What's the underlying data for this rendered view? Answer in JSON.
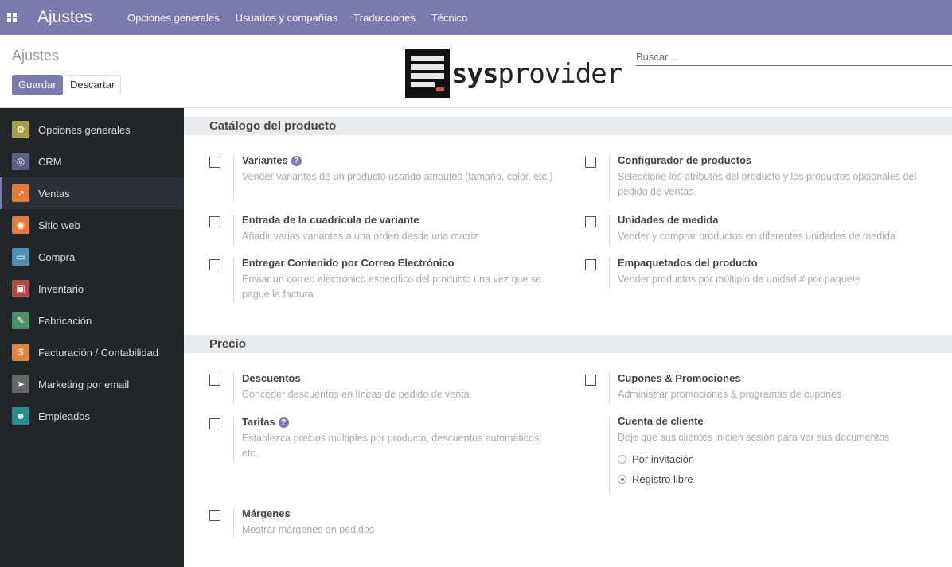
{
  "navbar": {
    "app_title": "Ajustes",
    "menu": [
      "Opciones generales",
      "Usuarios y compañías",
      "Traducciones",
      "Técnico"
    ]
  },
  "control_panel": {
    "title": "Ajustes",
    "save_label": "Guardar",
    "discard_label": "Descartar",
    "logo_text_bold": "sys",
    "logo_text": "provider",
    "search_placeholder": "Buscar..."
  },
  "sidebar": {
    "items": [
      {
        "label": "Opciones generales",
        "icon": "gear-icon",
        "color": "#a5a14b",
        "glyph": "⚙"
      },
      {
        "label": "CRM",
        "icon": "handshake-icon",
        "color": "#5b5f86",
        "glyph": "◎"
      },
      {
        "label": "Ventas",
        "icon": "chart-icon",
        "color": "#e07b39",
        "glyph": "↗"
      },
      {
        "label": "Sitio web",
        "icon": "globe-icon",
        "color": "#e27b3d",
        "glyph": "◉"
      },
      {
        "label": "Compra",
        "icon": "card-icon",
        "color": "#4e8fb5",
        "glyph": "▭"
      },
      {
        "label": "Inventario",
        "icon": "box-icon",
        "color": "#b04b4b",
        "glyph": "▣"
      },
      {
        "label": "Fabricación",
        "icon": "wrench-icon",
        "color": "#4f8f6b",
        "glyph": "✎"
      },
      {
        "label": "Facturación / Contabilidad",
        "icon": "invoice-icon",
        "color": "#e0873d",
        "glyph": "$"
      },
      {
        "label": "Marketing por email",
        "icon": "paper-plane-icon",
        "color": "#666666",
        "glyph": "➤"
      },
      {
        "label": "Empleados",
        "icon": "users-icon",
        "color": "#2a8c8c",
        "glyph": "☻"
      }
    ],
    "active_index": 2
  },
  "sections": {
    "catalog_title": "Catálogo del producto",
    "price_title": "Precio"
  },
  "settings": {
    "variantes": {
      "title": "Variantes",
      "desc": "Vender variantes de un producto usando atributos (tamaño, color, etc.)"
    },
    "configurador": {
      "title": "Configurador de productos",
      "desc": "Seleccione los atributos del producto y los productos opcionales del pedido de ventas."
    },
    "cuadricula": {
      "title": "Entrada de la cuadrícula de variante",
      "desc": "Añadir varias variantes a una orden desde una matriz"
    },
    "unidades": {
      "title": "Unidades de medida",
      "desc": "Vender y comprar productos en diferentes unidades de medida"
    },
    "contenido": {
      "title": "Entregar Contenido por Correo Electrónico",
      "desc": "Enviar un correo electrónico específico del producto una vez que se pague la factura"
    },
    "empaquetados": {
      "title": "Empaquetados del producto",
      "desc": "Vender productos por múltiplo de unidad # por paquete"
    },
    "descuentos": {
      "title": "Descuentos",
      "desc": "Conceder descuentos en líneas de pedido de venta"
    },
    "cupones": {
      "title": "Cupones & Promociones",
      "desc": "Administrar promociones & programas de cupones"
    },
    "tarifas": {
      "title": "Tarifas",
      "desc": "Establezca precios múltiples por producto, descuentos automáticos, etc."
    },
    "cuenta": {
      "title": "Cuenta de cliente",
      "desc": "Deje que sus clientes inicien sesión para ver sus documentos",
      "options": [
        "Por invitación",
        "Registro libre"
      ],
      "selected": "Registro libre"
    },
    "margenes": {
      "title": "Márgenes",
      "desc": "Mostrar márgenes en pedidos"
    }
  }
}
